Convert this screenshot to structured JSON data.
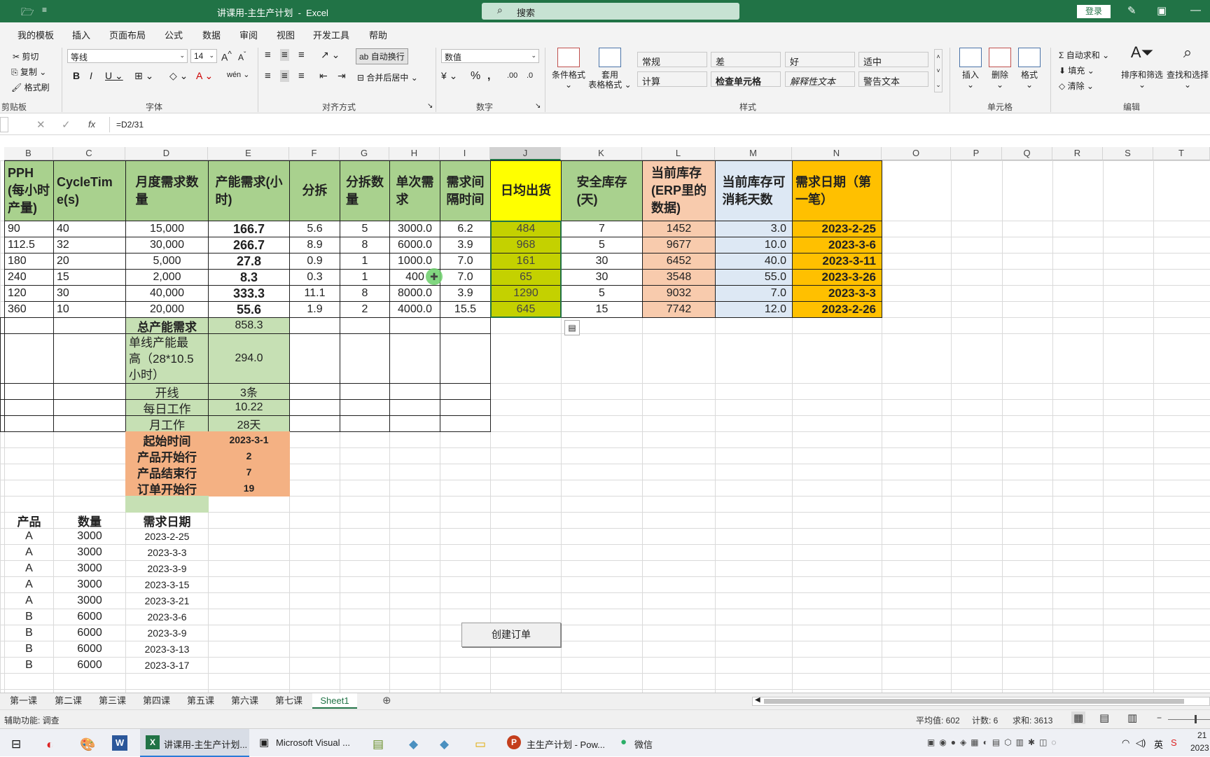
{
  "window": {
    "title": "讲课用-主生产计划",
    "app": "Excel",
    "search_placeholder": "搜索",
    "login": "登录"
  },
  "menu": [
    "我的模板",
    "插入",
    "页面布局",
    "公式",
    "数据",
    "审阅",
    "视图",
    "开发工具",
    "帮助"
  ],
  "ribbon": {
    "clipboard": {
      "cut": "剪切",
      "copy": "复制",
      "painter": "格式刷",
      "group": "剪贴板"
    },
    "font": {
      "name": "等线",
      "size": "14",
      "group": "字体"
    },
    "align": {
      "wrap": "自动换行",
      "merge": "合并后居中",
      "group": "对齐方式"
    },
    "number": {
      "format": "数值",
      "group": "数字"
    },
    "styles": {
      "cond": "条件格式",
      "table1": "套用",
      "table2": "表格格式",
      "group": "样式",
      "cells": [
        {
          "t": "常规",
          "bg": "#ffffff",
          "fg": "#222222",
          "b": "#888888"
        },
        {
          "t": "差",
          "bg": "#ffc7ce",
          "fg": "#9c0006",
          "b": "#ffc7ce"
        },
        {
          "t": "好",
          "bg": "#c6efce",
          "fg": "#006100",
          "b": "#c6efce"
        },
        {
          "t": "适中",
          "bg": "#ffeb9c",
          "fg": "#9c5700",
          "b": "#ffeb9c"
        },
        {
          "t": "计算",
          "bg": "#f2f2f2",
          "fg": "#fa7d00",
          "b": "#7f7f7f"
        },
        {
          "t": "检查单元格",
          "bg": "#a5a5a5",
          "fg": "#ffffff",
          "b": "#3f3f3f"
        },
        {
          "t": "解释性文本",
          "bg": "#ffffff",
          "fg": "#7f7f7f",
          "b": "#ffffff"
        },
        {
          "t": "警告文本",
          "bg": "#ffffff",
          "fg": "#ff0000",
          "b": "#ffffff"
        }
      ]
    },
    "cells_grp": {
      "insert": "插入",
      "delete": "删除",
      "format": "格式",
      "group": "单元格"
    },
    "edit": {
      "autosum": "自动求和",
      "fill": "填充",
      "clear": "清除",
      "sort": "排序和筛选",
      "find": "查找和选择",
      "group": "编辑"
    }
  },
  "formula": {
    "text": "=D2/31"
  },
  "columns": [
    "B",
    "C",
    "D",
    "E",
    "F",
    "G",
    "H",
    "I",
    "J",
    "K",
    "L",
    "M",
    "N",
    "O",
    "P",
    "Q",
    "R",
    "S",
    "T"
  ],
  "headers": [
    "PPH\n(每小时\n产量)",
    "CycleTim\ne(s)",
    "月度需求数\n量",
    "产能需求(小\n时)",
    "分拆",
    "分拆数\n量",
    "单次需\n求",
    "需求间\n隔时间",
    "日均出货",
    "安全库存\n(天)",
    "当前库存\n(ERP里的\n数据)",
    "当前库存可\n消耗天数",
    "需求日期（第\n一笔）"
  ],
  "rows": [
    [
      "90",
      "40",
      "15,000",
      "166.7",
      "5.6",
      "5",
      "3000.0",
      "6.2",
      "484",
      "7",
      "1452",
      "3.0",
      "2023-2-25"
    ],
    [
      "112.5",
      "32",
      "30,000",
      "266.7",
      "8.9",
      "8",
      "6000.0",
      "3.9",
      "968",
      "5",
      "9677",
      "10.0",
      "2023-3-6"
    ],
    [
      "180",
      "20",
      "5,000",
      "27.8",
      "0.9",
      "1",
      "1000.0",
      "7.0",
      "161",
      "30",
      "6452",
      "40.0",
      "2023-3-11"
    ],
    [
      "240",
      "15",
      "2,000",
      "8.3",
      "0.3",
      "1",
      "400",
      "7.0",
      "65",
      "30",
      "3548",
      "55.0",
      "2023-3-26"
    ],
    [
      "120",
      "30",
      "40,000",
      "333.3",
      "11.1",
      "8",
      "8000.0",
      "3.9",
      "1290",
      "5",
      "9032",
      "7.0",
      "2023-3-3"
    ],
    [
      "360",
      "10",
      "20,000",
      "55.6",
      "1.9",
      "2",
      "4000.0",
      "15.5",
      "645",
      "15",
      "7742",
      "12.0",
      "2023-2-26"
    ]
  ],
  "summary": [
    {
      "label": "总产能需求",
      "value": "858.3"
    },
    {
      "label": "单线产能最\n高（28*10.5\n小时）",
      "value": "294.0"
    },
    {
      "label": "开线",
      "value": "3条"
    },
    {
      "label": "每日工作",
      "value": "10.22"
    },
    {
      "label": "月工作",
      "value": "28天"
    }
  ],
  "params": [
    {
      "label": "起始时间",
      "value": "2023-3-1"
    },
    {
      "label": "产品开始行",
      "value": "2"
    },
    {
      "label": "产品结束行",
      "value": "7"
    },
    {
      "label": "订单开始行",
      "value": "19"
    }
  ],
  "create_button": "创建订单",
  "orders_header": [
    "产品",
    "数量",
    "需求日期"
  ],
  "orders": [
    [
      "A",
      "3000",
      "2023-2-25"
    ],
    [
      "A",
      "3000",
      "2023-3-3"
    ],
    [
      "A",
      "3000",
      "2023-3-9"
    ],
    [
      "A",
      "3000",
      "2023-3-15"
    ],
    [
      "A",
      "3000",
      "2023-3-21"
    ],
    [
      "B",
      "6000",
      "2023-3-6"
    ],
    [
      "B",
      "6000",
      "2023-3-9"
    ],
    [
      "B",
      "6000",
      "2023-3-13"
    ],
    [
      "B",
      "6000",
      "2023-3-17"
    ]
  ],
  "sheets": [
    "第一课",
    "第二课",
    "第三课",
    "第四课",
    "第五课",
    "第六课",
    "第七课",
    "Sheet1"
  ],
  "status": {
    "left": "辅助功能: 调查",
    "avg": "平均值: 602",
    "count": "计数: 6",
    "sum": "求和: 3613"
  },
  "taskbar": {
    "items": [
      "讲课用-主生产计划...",
      "Microsoft Visual ...",
      "主生产计划 - Pow...",
      "微信"
    ],
    "ime": "英",
    "time": "21",
    "date": "2023"
  },
  "colors": {
    "green": "#a9d18e",
    "lightgreen": "#c6e0b4",
    "yellow": "#ffff00",
    "olive": "#c4d100",
    "salmon": "#f8cbad",
    "blue": "#dde8f4",
    "orange": "#ffc000",
    "param": "#f4b183"
  }
}
